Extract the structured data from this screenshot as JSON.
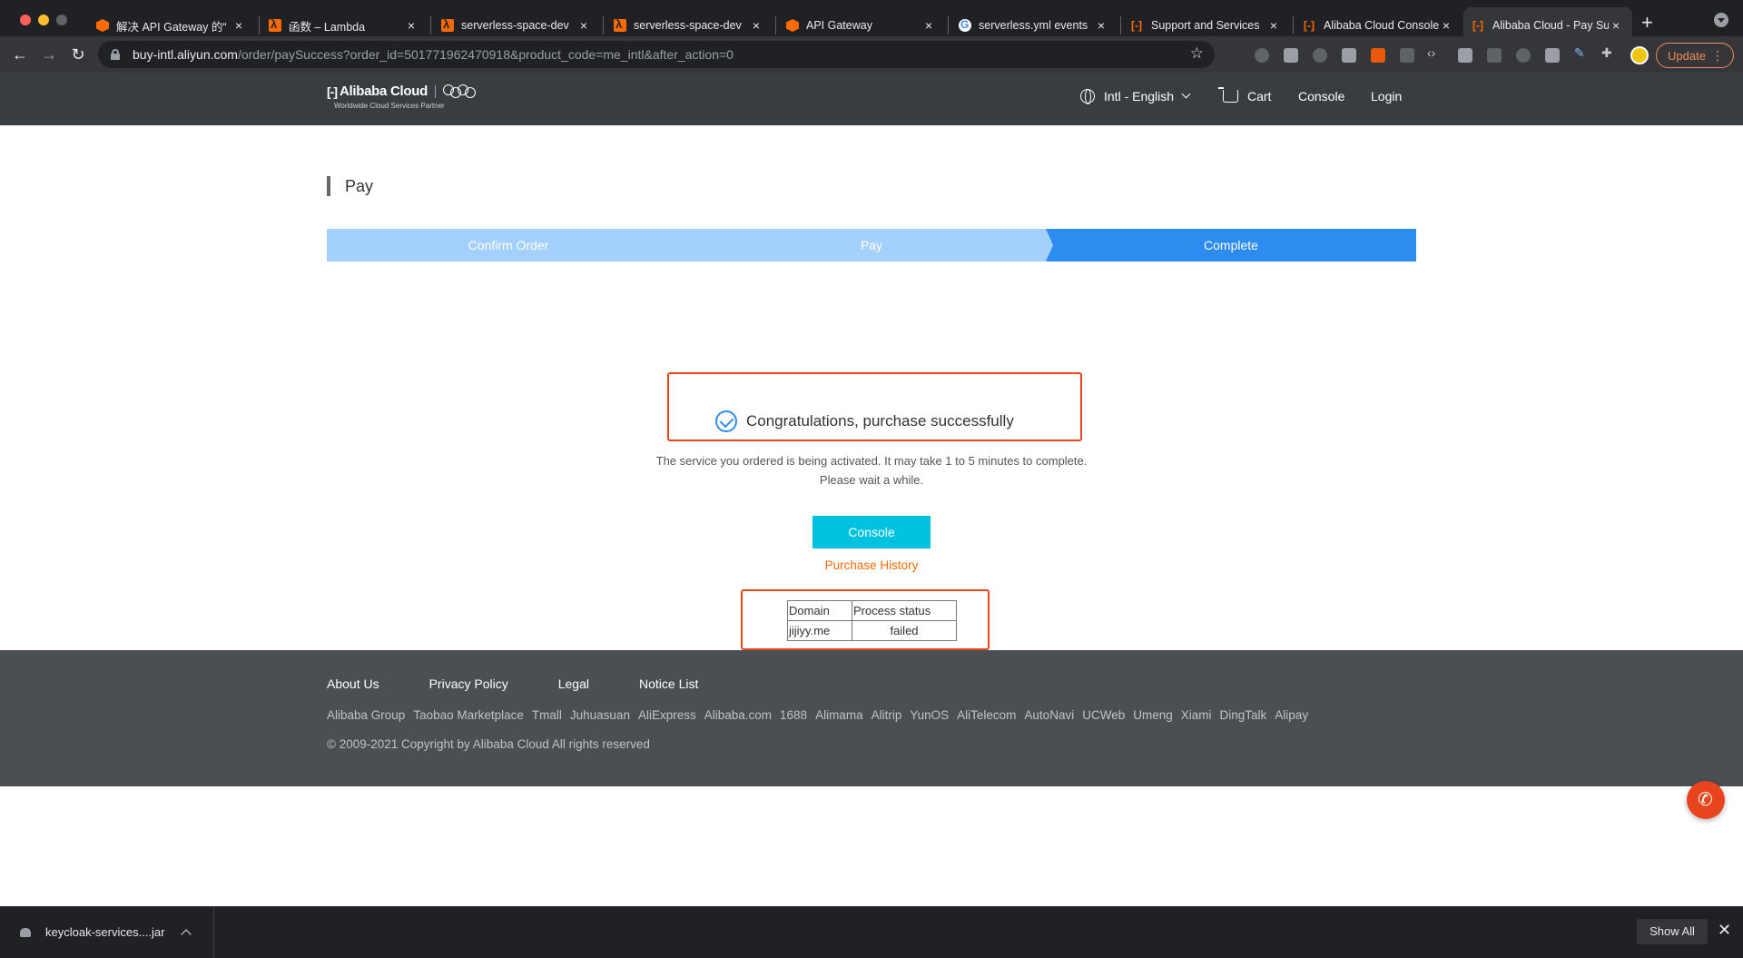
{
  "browser": {
    "tabs": [
      {
        "title": "解决 API Gateway 的“",
        "favicon": "hexagon-icon"
      },
      {
        "title": "函数 – Lambda",
        "favicon": "lambda-icon"
      },
      {
        "title": "serverless-space-dev",
        "favicon": "lambda-icon"
      },
      {
        "title": "serverless-space-dev",
        "favicon": "lambda-icon"
      },
      {
        "title": "API Gateway",
        "favicon": "hexagon-icon"
      },
      {
        "title": "serverless.yml events",
        "favicon": "google-icon"
      },
      {
        "title": "Support and Services",
        "favicon": "alibaba-cloud-icon"
      },
      {
        "title": "Alibaba Cloud Console",
        "favicon": "alibaba-cloud-icon"
      },
      {
        "title": "Alibaba Cloud - Pay Su",
        "favicon": "alibaba-cloud-icon",
        "active": true
      }
    ],
    "url_host": "buy-intl.aliyun.com",
    "url_path": "/order/paySuccess?order_id=501771962470918&product_code=me_intl&after_action=0",
    "update_label": "Update"
  },
  "header": {
    "logo_text": "Alibaba Cloud",
    "logo_tagline": "Worldwide Cloud Services Partner",
    "language": "Intl - English",
    "cart": "Cart",
    "console": "Console",
    "login": "Login"
  },
  "page": {
    "title": "Pay",
    "steps": [
      "Confirm Order",
      "Pay",
      "Complete"
    ],
    "active_step": "Complete",
    "success_message": "Congratulations, purchase successfully",
    "description_line1": "The service you ordered is being activated. It may take 1 to 5 minutes to complete.",
    "description_line2": "Please wait a while.",
    "console_button": "Console",
    "purchase_history_link": "Purchase History",
    "table": {
      "headers": [
        "Domain",
        "Process status"
      ],
      "rows": [
        [
          "jijiyy.me",
          "failed"
        ]
      ]
    }
  },
  "footer": {
    "links": [
      "About Us",
      "Privacy Policy",
      "Legal",
      "Notice List"
    ],
    "group_links": [
      "Alibaba Group",
      "Taobao Marketplace",
      "Tmall",
      "Juhuasuan",
      "AliExpress",
      "Alibaba.com",
      "1688",
      "Alimama",
      "Alitrip",
      "YunOS",
      "AliTelecom",
      "AutoNavi",
      "UCWeb",
      "Umeng",
      "Xiami",
      "DingTalk",
      "Alipay"
    ],
    "copyright": "© 2009-2021 Copyright by Alibaba Cloud All rights reserved"
  },
  "download_bar": {
    "file_name": "keycloak-services....jar",
    "show_all": "Show All"
  },
  "colors": {
    "header_bg": "#373d41",
    "footer_bg": "#4a4f53",
    "step_inactive": "#a3d0fc",
    "step_active": "#2d8cf0",
    "console_button": "#00c1de",
    "link_orange": "#ff6a00",
    "annotation_red": "#e8451e"
  }
}
